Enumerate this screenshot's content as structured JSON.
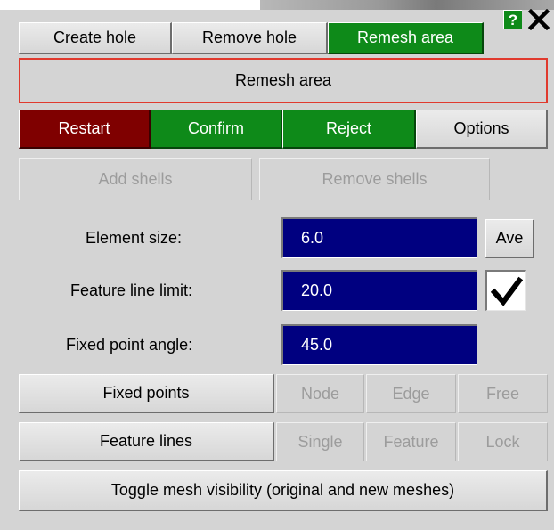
{
  "tabs": {
    "create_hole": "Create hole",
    "remove_hole": "Remove hole",
    "remesh_area": "Remesh area"
  },
  "window_controls": {
    "help": "?",
    "help_icon": "question-mark-icon",
    "close_icon": "close-x-icon"
  },
  "banner": {
    "title": "Remesh area"
  },
  "actions": {
    "restart": "Restart",
    "confirm": "Confirm",
    "reject": "Reject",
    "options": "Options"
  },
  "shells": {
    "add": "Add shells",
    "remove": "Remove shells"
  },
  "params": {
    "element_size_label": "Element size:",
    "element_size_value": "6.0",
    "average_button": "Ave",
    "feature_line_limit_label": "Feature line limit:",
    "feature_line_limit_value": "20.0",
    "feature_line_limit_checked": true,
    "fixed_point_angle_label": "Fixed point angle:",
    "fixed_point_angle_value": "45.0"
  },
  "fixed_points": {
    "label": "Fixed points",
    "options": [
      "Node",
      "Edge",
      "Free"
    ]
  },
  "feature_lines": {
    "label": "Feature lines",
    "options": [
      "Single",
      "Feature",
      "Lock"
    ]
  },
  "toggle_visibility": "Toggle mesh visibility (original and new meshes)",
  "colors": {
    "active": "#0e8a19",
    "restart": "#7f0000",
    "field": "#000080",
    "banner_border": "#e03a2e",
    "panel": "#d4d4d4"
  }
}
